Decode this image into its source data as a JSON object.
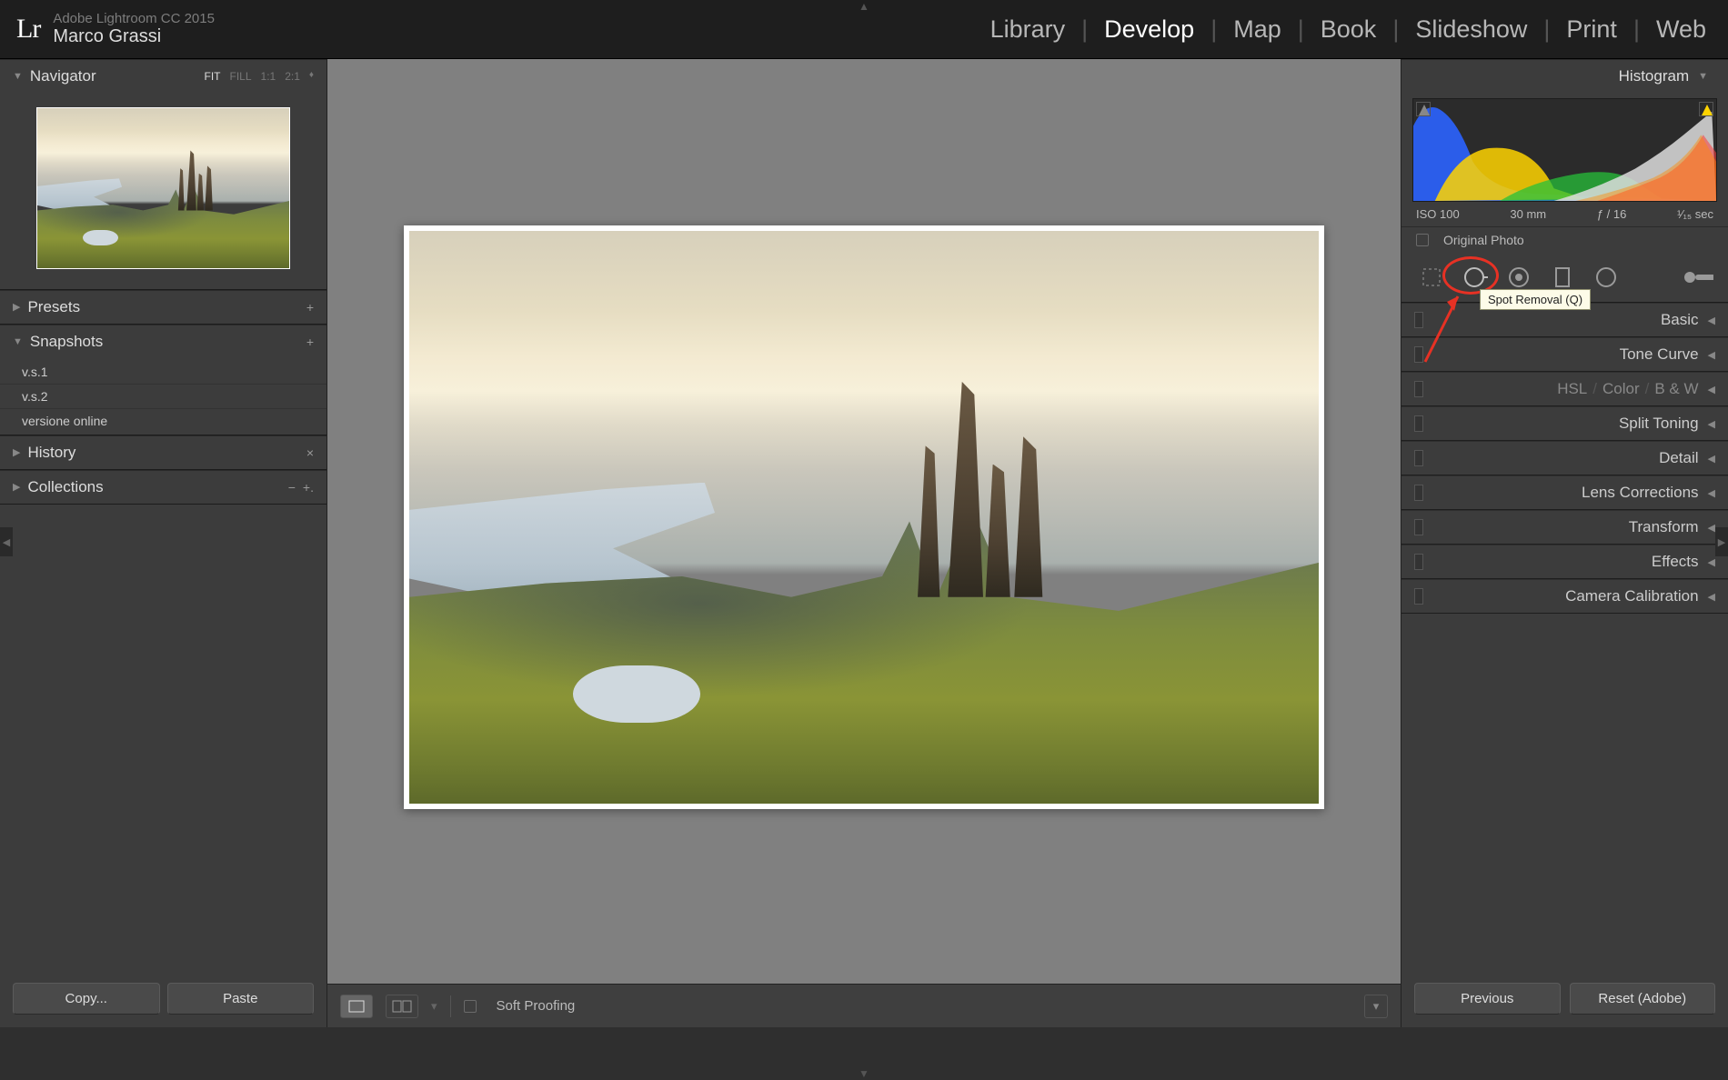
{
  "header": {
    "app_name": "Adobe Lightroom CC 2015",
    "user_name": "Marco Grassi",
    "modules": [
      "Library",
      "Develop",
      "Map",
      "Book",
      "Slideshow",
      "Print",
      "Web"
    ],
    "active_module": "Develop"
  },
  "left": {
    "navigator": {
      "title": "Navigator",
      "zoom_options": [
        "FIT",
        "FILL",
        "1:1",
        "2:1"
      ],
      "zoom_selected": "FIT"
    },
    "presets": {
      "title": "Presets"
    },
    "snapshots": {
      "title": "Snapshots",
      "items": [
        "v.s.1",
        "v.s.2",
        "versione online"
      ]
    },
    "history": {
      "title": "History"
    },
    "collections": {
      "title": "Collections"
    },
    "buttons": {
      "copy": "Copy...",
      "paste": "Paste"
    }
  },
  "center": {
    "soft_proofing_label": "Soft Proofing"
  },
  "right": {
    "histogram": {
      "title": "Histogram",
      "iso": "ISO 100",
      "focal": "30 mm",
      "aperture": "ƒ / 16",
      "shutter_html": "¹⁄₁₅ sec",
      "original_photo_label": "Original Photo"
    },
    "tools": {
      "names": [
        "crop",
        "spot-removal",
        "red-eye",
        "graduated-filter",
        "radial-filter",
        "adjustment-brush"
      ],
      "tooltip": "Spot Removal (Q)"
    },
    "panels": {
      "basic": "Basic",
      "tone_curve": "Tone Curve",
      "hsl": "HSL",
      "color": "Color",
      "bw": "B & W",
      "split_toning": "Split Toning",
      "detail": "Detail",
      "lens": "Lens Corrections",
      "transform": "Transform",
      "effects": "Effects",
      "calibration": "Camera Calibration"
    },
    "buttons": {
      "previous": "Previous",
      "reset": "Reset (Adobe)"
    }
  }
}
